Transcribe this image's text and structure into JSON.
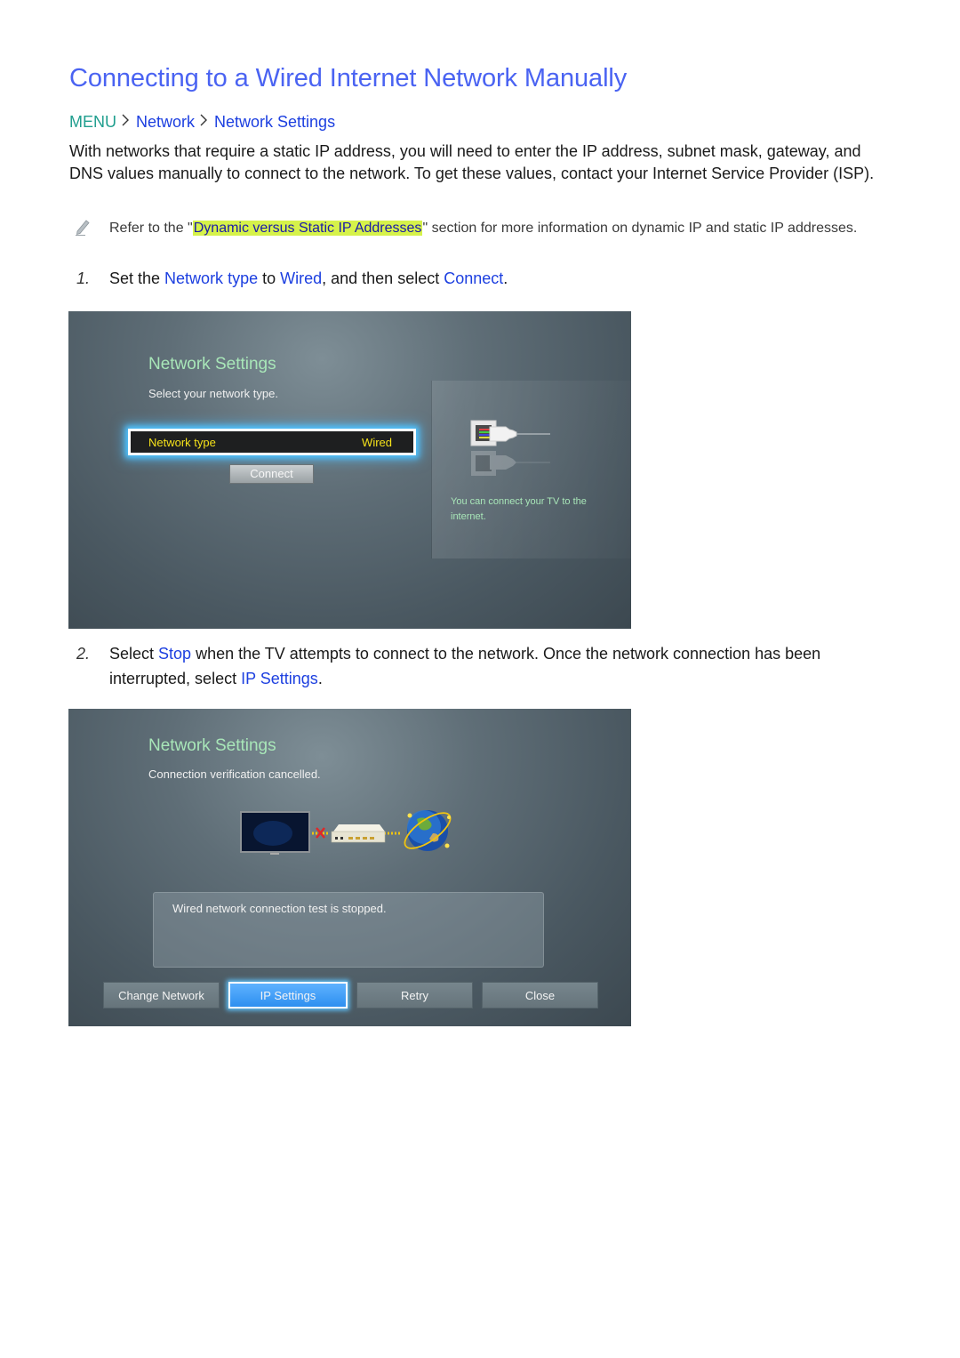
{
  "title": "Connecting to a Wired Internet Network Manually",
  "breadcrumb": {
    "menu": "MENU",
    "separator": ">",
    "items": [
      "Network",
      "Network Settings"
    ]
  },
  "intro": "With networks that require a static IP address, you will need to enter the IP address, subnet mask, gateway, and DNS values manually to connect to the network. To get these values, contact your Internet Service Provider (ISP).",
  "note": {
    "icon": "pencil-icon",
    "before": "Refer to the \"",
    "link": "Dynamic versus Static IP Addresses",
    "after": "\" section for more information on dynamic IP and static IP addresses."
  },
  "steps": [
    {
      "num": "1.",
      "parts": [
        "Set the ",
        "Network type",
        " to ",
        "Wired",
        ", and then select ",
        "Connect",
        "."
      ]
    },
    {
      "num": "2.",
      "parts": [
        "Select ",
        "Stop",
        " when the TV attempts to connect to the network. Once the network connection has been interrupted, select ",
        "IP Settings",
        "."
      ]
    }
  ],
  "screen1": {
    "title": "Network Settings",
    "subtitle": "Select your network type.",
    "network_type_label": "Network type",
    "network_type_value": "Wired",
    "connect_button": "Connect",
    "side_text": "You can connect your TV to the internet.",
    "side_icon": "ethernet-plug-icon"
  },
  "screen2": {
    "title": "Network Settings",
    "subtitle": "Connection verification cancelled.",
    "diagram_icons": [
      "tv-icon",
      "disconnected-x-icon",
      "router-icon",
      "globe-icon"
    ],
    "message": "Wired network connection test is stopped.",
    "buttons": [
      "Change Network",
      "IP Settings",
      "Retry",
      "Close"
    ],
    "focused_button": "IP Settings"
  },
  "colors": {
    "title": "#4a63f2",
    "menu": "#1f9e8e",
    "keyword": "#1c3fe0",
    "highlight": "#d6f24a",
    "tv_title": "#a8e6b8",
    "tv_selected_text": "#f5e21a",
    "focus_glow": "#4fc3ff"
  }
}
